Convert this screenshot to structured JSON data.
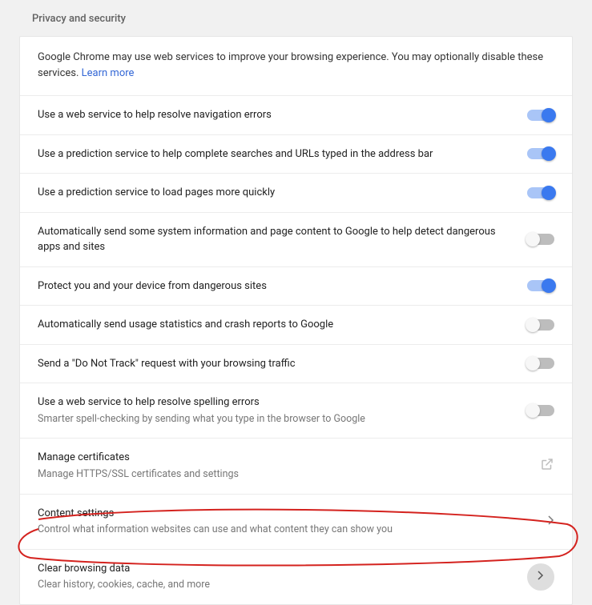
{
  "section_title": "Privacy and security",
  "intro_text": "Google Chrome may use web services to improve your browsing experience. You may optionally disable these services. ",
  "learn_more": "Learn more",
  "rows": [
    {
      "label": "Use a web service to help resolve navigation errors",
      "sub": "",
      "ctrl": "toggle",
      "on": true
    },
    {
      "label": "Use a prediction service to help complete searches and URLs typed in the address bar",
      "sub": "",
      "ctrl": "toggle",
      "on": true
    },
    {
      "label": "Use a prediction service to load pages more quickly",
      "sub": "",
      "ctrl": "toggle",
      "on": true
    },
    {
      "label": "Automatically send some system information and page content to Google to help detect dangerous apps and sites",
      "sub": "",
      "ctrl": "toggle",
      "on": false
    },
    {
      "label": "Protect you and your device from dangerous sites",
      "sub": "",
      "ctrl": "toggle",
      "on": true
    },
    {
      "label": "Automatically send usage statistics and crash reports to Google",
      "sub": "",
      "ctrl": "toggle",
      "on": false
    },
    {
      "label": "Send a \"Do Not Track\" request with your browsing traffic",
      "sub": "",
      "ctrl": "toggle",
      "on": false
    },
    {
      "label": "Use a web service to help resolve spelling errors",
      "sub": "Smarter spell-checking by sending what you type in the browser to Google",
      "ctrl": "toggle",
      "on": false
    },
    {
      "label": "Manage certificates",
      "sub": "Manage HTTPS/SSL certificates and settings",
      "ctrl": "external"
    },
    {
      "label": "Content settings",
      "sub": "Control what information websites can use and what content they can show you",
      "ctrl": "chevron"
    },
    {
      "label": "Clear browsing data",
      "sub": "Clear history, cookies, cache, and more",
      "ctrl": "circle-chevron"
    }
  ]
}
